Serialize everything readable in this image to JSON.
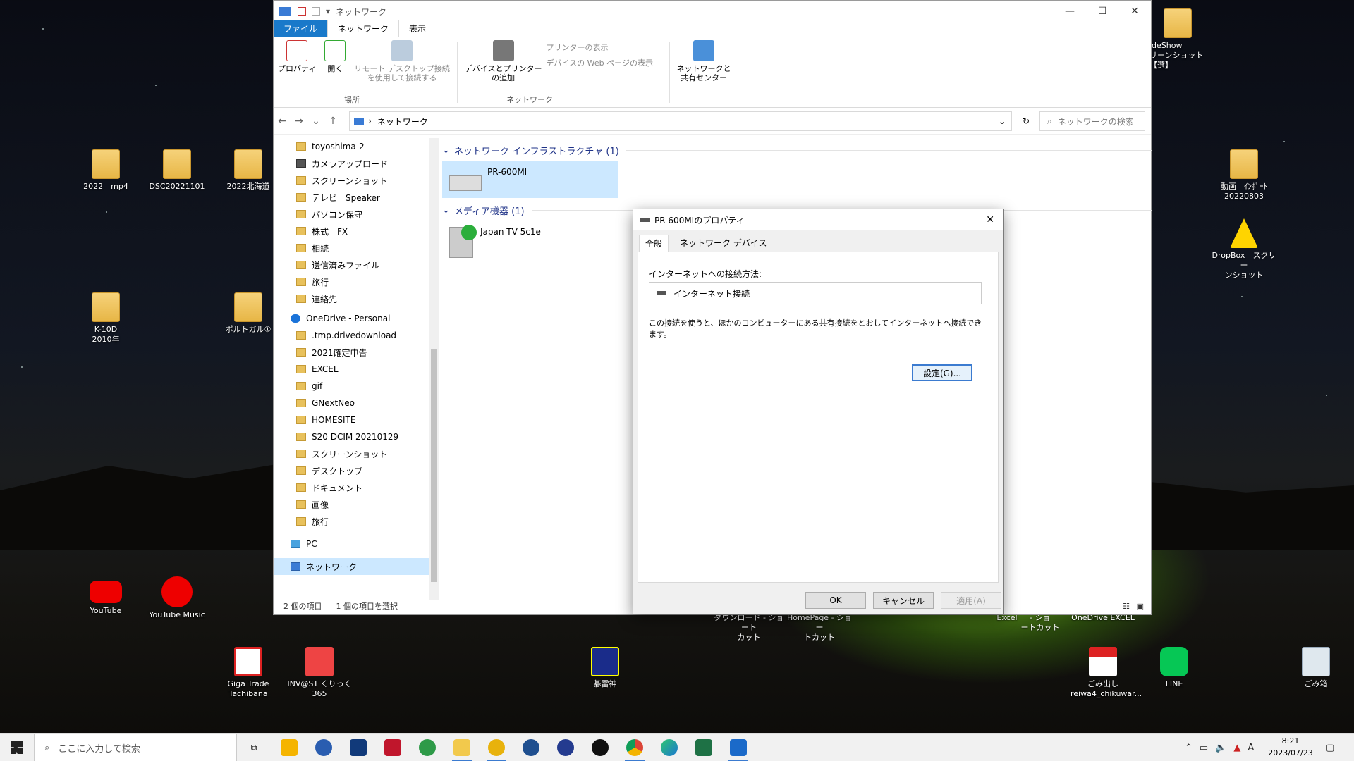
{
  "desktop": {
    "icons": [
      {
        "label": "2022　mp4",
        "icon": "folder-icon"
      },
      {
        "label": "DSC20221101",
        "icon": "folder-icon"
      },
      {
        "label": "2022北海道",
        "icon": "folder-icon"
      },
      {
        "label": "K-10D\n2010年",
        "icon": "folder-icon"
      },
      {
        "label": "ポルトガル①",
        "icon": "folder-icon"
      },
      {
        "label": "YouTube",
        "icon": "youtube-icon"
      },
      {
        "label": "YouTube Music",
        "icon": "youtube-music-icon"
      },
      {
        "label": "Giga Trade\nTachibana",
        "icon": "giga-trade-icon"
      },
      {
        "label": "INV@ST くりっく365",
        "icon": "invest-icon"
      },
      {
        "label": "碁雷神",
        "icon": "goraijin-icon"
      },
      {
        "label": "ごみ出し\nreiwa4_chikuwar...",
        "icon": "pdf-icon"
      },
      {
        "label": "LINE",
        "icon": "line-icon"
      },
      {
        "label": "ごみ箱",
        "icon": "recycle-bin-icon"
      },
      {
        "label": "ideShow\nリーンショット【選】",
        "icon": "folder-icon"
      },
      {
        "label": "動画　ｲﾝﾎﾟｰﾄ\n20220803",
        "icon": "folder-icon"
      },
      {
        "label": "DropBox　スクリー\nンショット",
        "icon": "warning-icon"
      }
    ],
    "partial_labels": [
      "ダウンロード - ショート\nカット",
      "HomePage - ショー\nトカット",
      "Excel",
      "- ショ\nートカット",
      "OneDrive EXCEL"
    ]
  },
  "explorer": {
    "title": "ネットワーク",
    "tabs": [
      "ファイル",
      "ネットワーク",
      "表示"
    ],
    "ribbon": {
      "properties": "プロパティ",
      "open": "開く",
      "remote_desktop": "リモート デスクトップ接続\nを使用して接続する",
      "location_group": "場所",
      "add_devices": "デバイスとプリンター\nの追加",
      "view_printers": "プリンターの表示",
      "view_device_web": "デバイスの Web ページの表示",
      "network_group": "ネットワーク",
      "network_center": "ネットワークと\n共有センター"
    },
    "address": "ネットワーク",
    "search_placeholder": "ネットワークの検索",
    "tree": [
      "toyoshima-2",
      "カメラアップロード",
      "スクリーンショット",
      "テレビ　Speaker",
      "パソコン保守",
      "株式　FX",
      "相続",
      "送信済みファイル",
      "旅行",
      "連絡先",
      "OneDrive - Personal",
      ".tmp.drivedownload",
      "2021確定申告",
      "EXCEL",
      "gif",
      "GNextNeo",
      "HOMESITE",
      "S20 DCIM 20210129",
      "スクリーンショット",
      "デスクトップ",
      "ドキュメント",
      "画像",
      "旅行",
      "PC",
      "ネットワーク"
    ],
    "groups": [
      {
        "header": "ネットワーク インフラストラクチャ (1)",
        "items": [
          "PR-600MI"
        ]
      },
      {
        "header": "メディア機器 (1)",
        "items": [
          "Japan TV 5c1e"
        ]
      }
    ],
    "status": {
      "count": "2 個の項目",
      "selected": "1 個の項目を選択"
    }
  },
  "dialog": {
    "title": "PR-600MIのプロパティ",
    "tabs": [
      "全般",
      "ネットワーク デバイス"
    ],
    "connect_label": "インターネットへの接続方法:",
    "connection": "インターネット接続",
    "description": "この接続を使うと、ほかのコンピューターにある共有接続をとおしてインターネットへ接続できます。",
    "settings": "設定(G)...",
    "ok": "OK",
    "cancel": "キャンセル",
    "apply": "適用(A)"
  },
  "taskbar": {
    "search_placeholder": "ここに入力して検索",
    "time": "8:21",
    "date": "2023/07/23",
    "ime": "A"
  },
  "colors": {
    "accent": "#1979ca",
    "selection": "#cce8ff",
    "link": "#1e3287"
  }
}
